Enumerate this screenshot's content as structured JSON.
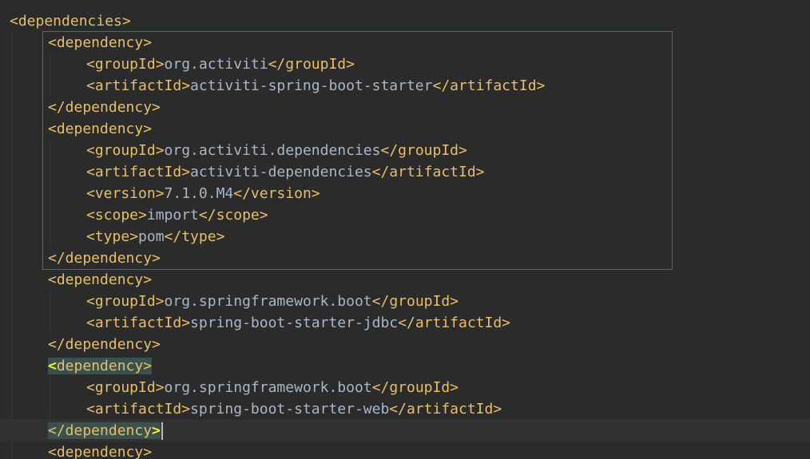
{
  "editor": {
    "lines": [
      {
        "indent": 0,
        "open": "<dependencies>"
      },
      {
        "indent": 1,
        "open": "<dependency>"
      },
      {
        "indent": 2,
        "open": "<groupId>",
        "text": "org.activiti",
        "close": "</groupId>"
      },
      {
        "indent": 2,
        "open": "<artifactId>",
        "text": "activiti-spring-boot-starter",
        "close": "</artifactId>"
      },
      {
        "indent": 1,
        "open": "</dependency>"
      },
      {
        "indent": 1,
        "open": "<dependency>"
      },
      {
        "indent": 2,
        "open": "<groupId>",
        "text": "org.activiti.dependencies",
        "close": "</groupId>"
      },
      {
        "indent": 2,
        "open": "<artifactId>",
        "text": "activiti-dependencies",
        "close": "</artifactId>"
      },
      {
        "indent": 2,
        "open": "<version>",
        "text": "7.1.0.M4",
        "close": "</version>"
      },
      {
        "indent": 2,
        "open": "<scope>",
        "text": "import",
        "close": "</scope>"
      },
      {
        "indent": 2,
        "open": "<type>",
        "text": "pom",
        "close": "</type>"
      },
      {
        "indent": 1,
        "open": "</dependency>"
      },
      {
        "indent": 1,
        "open": "<dependency>"
      },
      {
        "indent": 2,
        "open": "<groupId>",
        "text": "org.springframework.boot",
        "close": "</groupId>"
      },
      {
        "indent": 2,
        "open": "<artifactId>",
        "text": "spring-boot-starter-jdbc",
        "close": "</artifactId>"
      },
      {
        "indent": 1,
        "open": "</dependency>"
      },
      {
        "indent": 1,
        "open": "<dependency>",
        "matched": "open"
      },
      {
        "indent": 2,
        "open": "<groupId>",
        "text": "org.springframework.boot",
        "close": "</groupId>"
      },
      {
        "indent": 2,
        "open": "<artifactId>",
        "text": "spring-boot-starter-web",
        "close": "</artifactId>"
      },
      {
        "indent": 1,
        "open": "</dependency>",
        "matched": "close",
        "caret": true
      },
      {
        "indent": 1,
        "open": "<dependency>"
      }
    ],
    "highlight_box": {
      "from_line": 1,
      "to_line": 11,
      "color": "#d9302f"
    },
    "colors": {
      "background": "#2b2b2b",
      "tag": "#e8bf6a",
      "text": "#a9b7c6",
      "tag_match_background": "#3b514d",
      "bracket_match": "#ffef28"
    }
  }
}
